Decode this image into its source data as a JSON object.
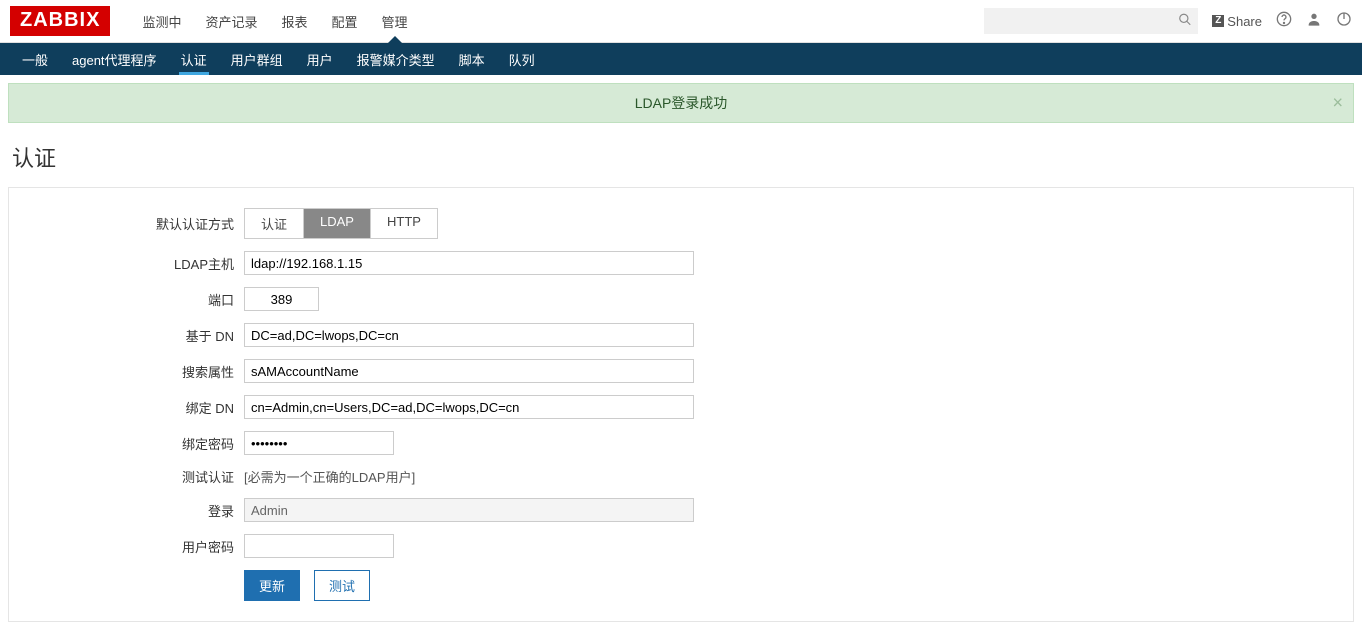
{
  "brand": "ZABBIX",
  "topnav": {
    "items": [
      {
        "label": "监测中",
        "active": false
      },
      {
        "label": "资产记录",
        "active": false
      },
      {
        "label": "报表",
        "active": false
      },
      {
        "label": "配置",
        "active": false
      },
      {
        "label": "管理",
        "active": true
      }
    ]
  },
  "right": {
    "share": "Share"
  },
  "subnav": {
    "items": [
      {
        "label": "一般",
        "active": false
      },
      {
        "label": "agent代理程序",
        "active": false
      },
      {
        "label": "认证",
        "active": true
      },
      {
        "label": "用户群组",
        "active": false
      },
      {
        "label": "用户",
        "active": false
      },
      {
        "label": "报警媒介类型",
        "active": false
      },
      {
        "label": "脚本",
        "active": false
      },
      {
        "label": "队列",
        "active": false
      }
    ]
  },
  "alert": {
    "text": "LDAP登录成功"
  },
  "page_title": "认证",
  "form": {
    "default_auth_label": "默认认证方式",
    "default_auth_options": [
      {
        "label": "认证",
        "selected": false
      },
      {
        "label": "LDAP",
        "selected": true
      },
      {
        "label": "HTTP",
        "selected": false
      }
    ],
    "ldap_host_label": "LDAP主机",
    "ldap_host_value": "ldap://192.168.1.15",
    "port_label": "端口",
    "port_value": "389",
    "base_dn_label": "基于 DN",
    "base_dn_value": "DC=ad,DC=lwops,DC=cn",
    "search_attr_label": "搜索属性",
    "search_attr_value": "sAMAccountName",
    "bind_dn_label": "绑定 DN",
    "bind_dn_value": "cn=Admin,cn=Users,DC=ad,DC=lwops,DC=cn",
    "bind_pw_label": "绑定密码",
    "bind_pw_value": "••••••••",
    "test_auth_label": "测试认证",
    "test_auth_text": "[必需为一个正确的LDAP用户]",
    "login_label": "登录",
    "login_value": "Admin",
    "user_pw_label": "用户密码",
    "user_pw_value": ""
  },
  "buttons": {
    "update": "更新",
    "test": "测试"
  }
}
